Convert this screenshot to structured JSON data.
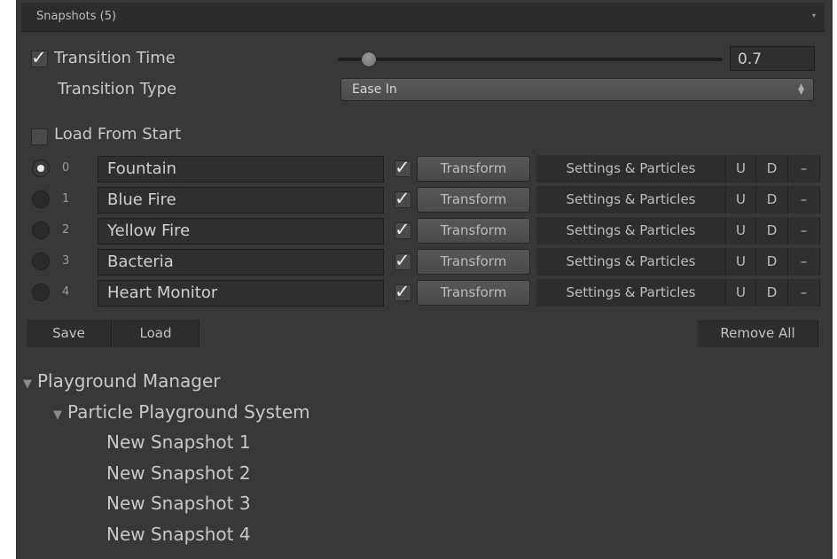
{
  "header": {
    "title": "Snapshots (5)",
    "dropdown_arrow": "▾"
  },
  "transition_time": {
    "checked": true,
    "label": "Transition Time",
    "value": "0.7",
    "slider_level": 0.07
  },
  "transition_type": {
    "label": "Transition Type",
    "value": "Ease In",
    "arrows": "▲▼"
  },
  "load_from_start": {
    "checked": false,
    "label": "Load From Start"
  },
  "snapshots": [
    {
      "index": "0",
      "name": "Fountain",
      "selected": true,
      "transform_checked": true,
      "transform_label": "Transform",
      "settings_label": "Settings & Particles",
      "u": "U",
      "d": "D",
      "remove": "–"
    },
    {
      "index": "1",
      "name": "Blue Fire",
      "selected": false,
      "transform_checked": true,
      "transform_label": "Transform",
      "settings_label": "Settings & Particles",
      "u": "U",
      "d": "D",
      "remove": "–"
    },
    {
      "index": "2",
      "name": "Yellow Fire",
      "selected": false,
      "transform_checked": true,
      "transform_label": "Transform",
      "settings_label": "Settings & Particles",
      "u": "U",
      "d": "D",
      "remove": "–"
    },
    {
      "index": "3",
      "name": "Bacteria",
      "selected": false,
      "transform_checked": true,
      "transform_label": "Transform",
      "settings_label": "Settings & Particles",
      "u": "U",
      "d": "D",
      "remove": "–"
    },
    {
      "index": "4",
      "name": "Heart Monitor",
      "selected": false,
      "transform_checked": true,
      "transform_label": "Transform",
      "settings_label": "Settings & Particles",
      "u": "U",
      "d": "D",
      "remove": "–"
    }
  ],
  "actions": {
    "save": "Save",
    "load": "Load",
    "remove_all": "Remove All"
  },
  "hierarchy": {
    "root": "Playground Manager",
    "child": "Particle Playground System",
    "items": [
      "New Snapshot 1",
      "New Snapshot 2",
      "New Snapshot 3",
      "New Snapshot 4"
    ]
  },
  "icons": {
    "check": "check-icon",
    "expand": "triangle-down-icon"
  }
}
